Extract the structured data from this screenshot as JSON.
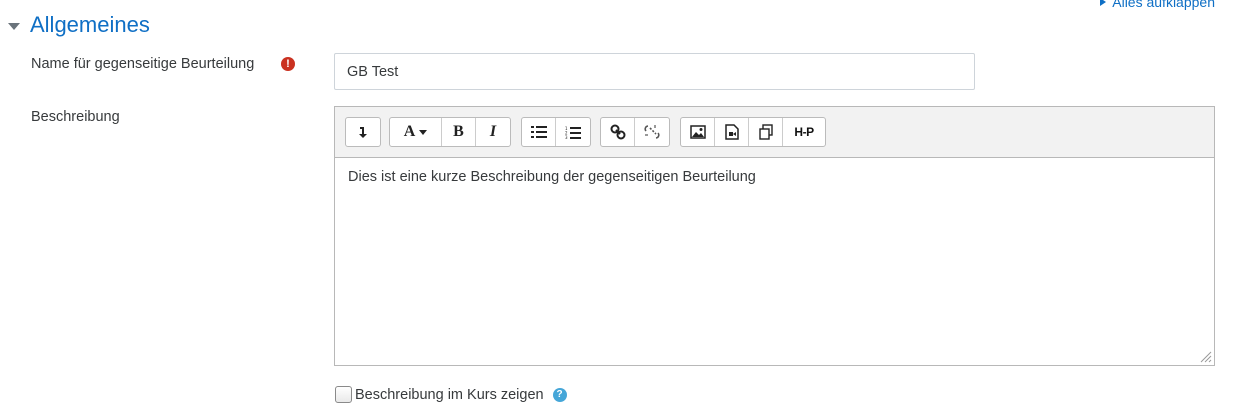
{
  "header": {
    "expand_all": "Alles aufklappen",
    "section_title": "Allgemeines"
  },
  "form": {
    "name_label": "Name für gegenseitige Beurteilung",
    "name_value": "GB Test",
    "required_marker": "!",
    "description_label": "Beschreibung",
    "description_text": "Dies ist eine kurze Beschreibung der gegenseitigen Beurteilung",
    "show_description_label": "Beschreibung im Kurs zeigen",
    "show_description_checked": false,
    "help_marker": "?"
  },
  "toolbar": {
    "font_button": "A",
    "bold_button": "B",
    "italic_button": "I",
    "h5p_button": "H-P"
  },
  "colors": {
    "link": "#0f6fc5",
    "required": "#ca3120",
    "help": "#45a6d8"
  }
}
